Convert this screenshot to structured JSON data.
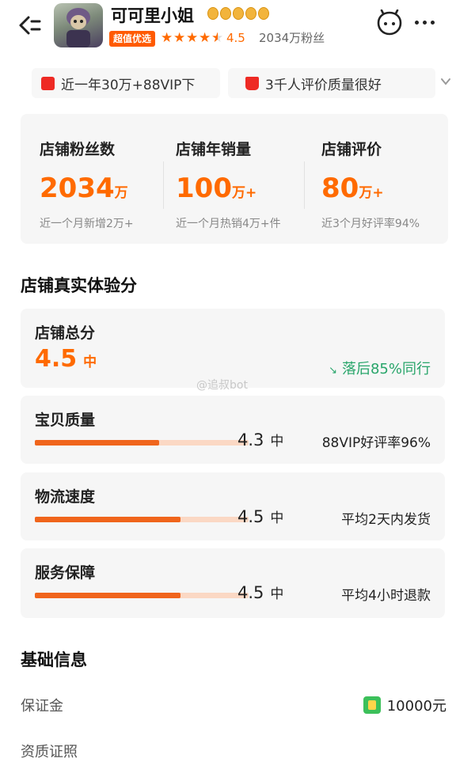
{
  "header": {
    "store_name": "可可里小姐",
    "badge_label": "超值优选",
    "rating": "4.5",
    "fans": "2034万粉丝",
    "star_count": 4.5
  },
  "highlights": [
    {
      "icon": "shopping-bag-icon",
      "text": "近一年30万+88VIP下"
    },
    {
      "icon": "thumbs-up-icon",
      "text": "3千人评价质量很好"
    }
  ],
  "stats": [
    {
      "label": "店铺粉丝数",
      "value": "2034",
      "unit": "万",
      "sub": "近一个月新增2万+"
    },
    {
      "label": "店铺年销量",
      "value": "100",
      "unit": "万+",
      "sub": "近一个月热销4万+件"
    },
    {
      "label": "店铺评价",
      "value": "80",
      "unit": "万+",
      "sub": "近3个月好评率94%"
    }
  ],
  "experience": {
    "title": "店铺真实体验分",
    "total": {
      "label": "店铺总分",
      "score": "4.5",
      "level": "中",
      "compare": "落后85%同行"
    },
    "items": [
      {
        "label": "宝贝质量",
        "score": "4.3",
        "level": "中",
        "note": "88VIP好评率96%",
        "fill": 0.58
      },
      {
        "label": "物流速度",
        "score": "4.5",
        "level": "中",
        "note": "平均2天内发货",
        "fill": 0.68
      },
      {
        "label": "服务保障",
        "score": "4.5",
        "level": "中",
        "note": "平均4小时退款",
        "fill": 0.68
      }
    ]
  },
  "watermark": "@追叔bot",
  "basic_info": {
    "title": "基础信息",
    "rows": [
      {
        "label": "保证金",
        "value": "10000元"
      },
      {
        "label": "资质证照",
        "value": ""
      }
    ]
  },
  "colors": {
    "accent": "#ff6a00",
    "green": "#28a56a",
    "bar": "#f0651c",
    "bar_track": "#fbd8c4"
  }
}
